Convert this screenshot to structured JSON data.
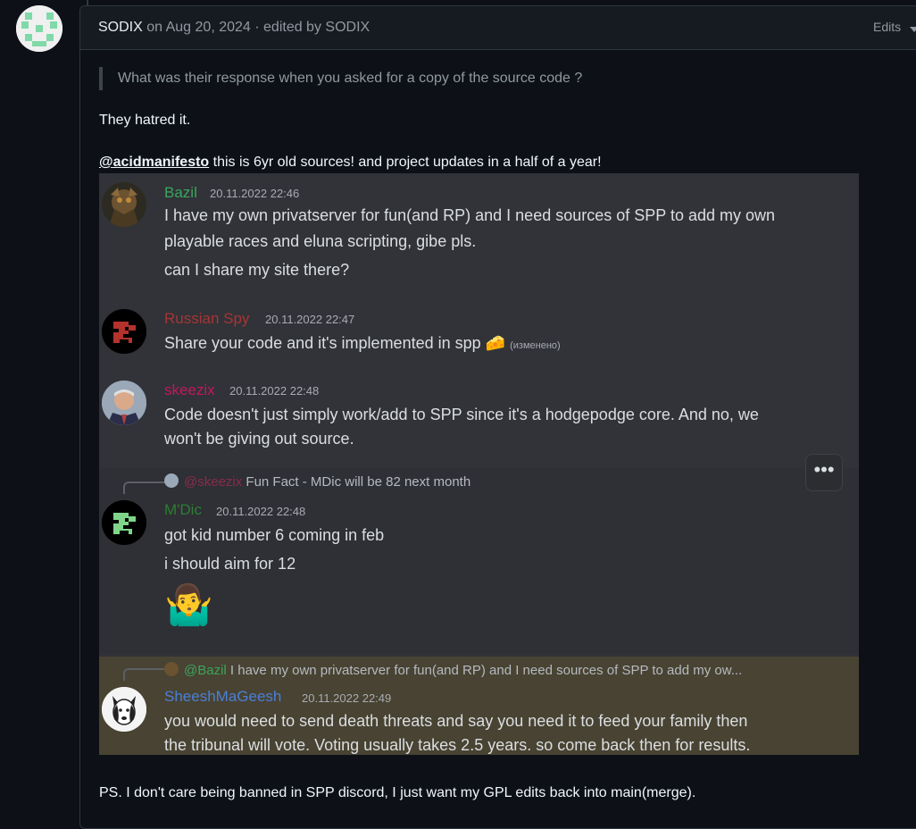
{
  "comment": {
    "author": "SODIX",
    "date_text": " on Aug 20, 2024 · edited by SODIX",
    "edits_label": "Edits",
    "quote": "What was their response when you asked for a copy of the source code ?",
    "p1": "They hatred it.",
    "mention": "@acidmanifesto",
    "p2_rest": " this is 6yr old sources! and project updates in a half of a year!",
    "p3": "PS. I don't care being banned in SPP discord, I just want my GPL edits back into main(merge)."
  },
  "discord": {
    "messages": [
      {
        "user": "Bazil",
        "name_color": "#3ba55d",
        "time": "20.11.2022 22:46",
        "lines": [
          "I have my own privatserver for fun(and RP) and I need sources of SPP to add my own",
          "playable races and eluna scripting, gibe pls.",
          "can I share my site there?"
        ]
      },
      {
        "user": "Russian Spy",
        "name_color": "#a93434",
        "time": "20.11.2022 22:47",
        "lines": [
          "Share your code and it's implemented in spp"
        ],
        "edited": "(изменено)"
      },
      {
        "user": "skeezix",
        "name_color": "#c2185b",
        "time": "20.11.2022 22:48",
        "lines": [
          "Code doesn't just simply work/add to SPP since it's a hodgepodge core. And no, we",
          "won't be giving out source."
        ]
      },
      {
        "user": "M'Dic",
        "name_color": "#2e7d32",
        "time": "20.11.2022 22:48",
        "reply_user": "@skeezix",
        "reply_user_color": "#8b2b4a",
        "reply_text": " Fun Fact - MDic will be 82 next month",
        "lines": [
          "got kid number 6 coming in feb",
          "i should aim for 12"
        ]
      },
      {
        "user": "SheeshMaGeesh",
        "name_color": "#4a7fd8",
        "time": "20.11.2022 22:49",
        "reply_user": "@Bazil",
        "reply_user_color": "#3ba55d",
        "reply_text": " I have my own privatserver for fun(and RP) and I need sources of SPP to add my ow...",
        "lines": [
          "you would need to send death threats and say you need it to feed your family then",
          "the tribunal will vote. Voting usually takes 2.5 years. so come back then for results."
        ]
      }
    ],
    "more_button": "•••",
    "emoji_shrug": "🤷‍♂️",
    "emoji_cheese": "🧀"
  }
}
